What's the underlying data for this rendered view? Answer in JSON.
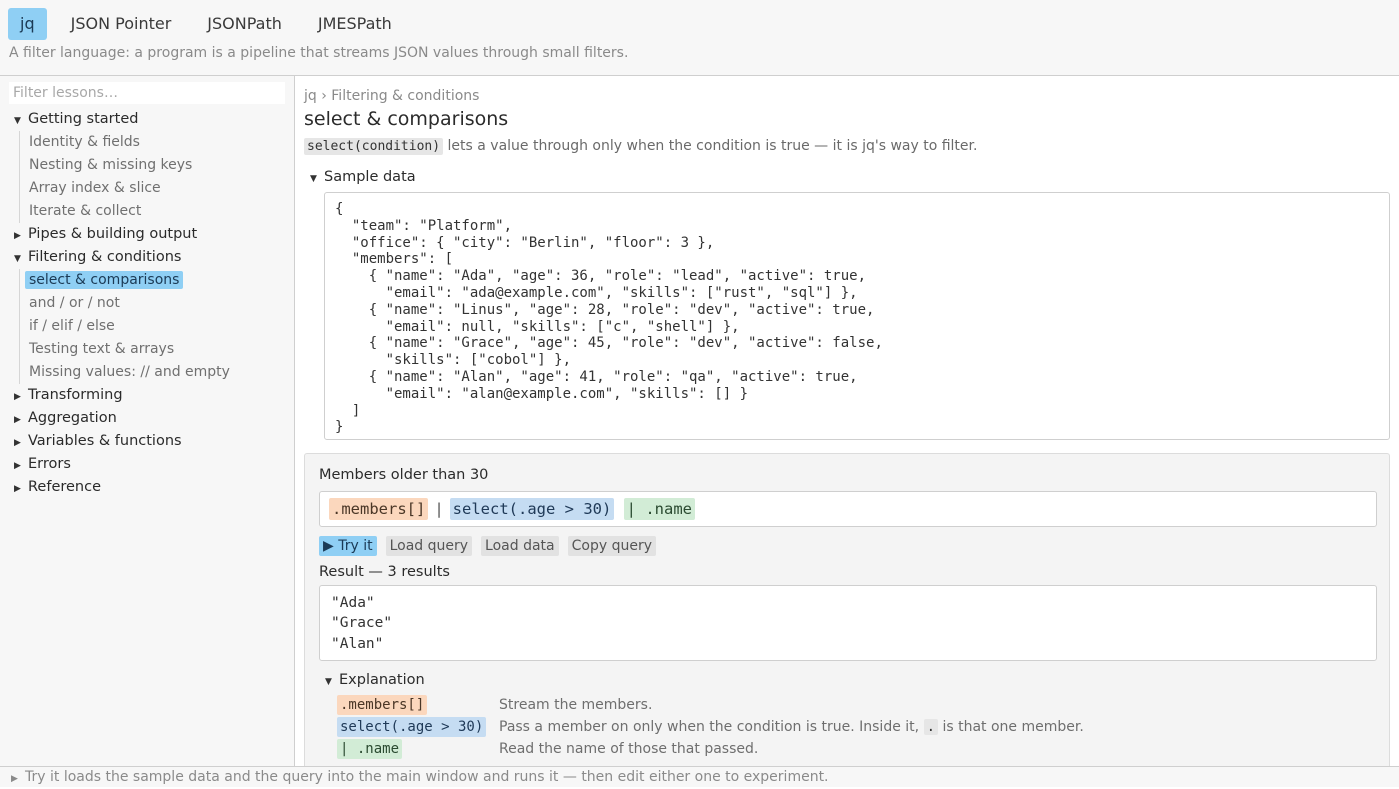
{
  "tabs": [
    {
      "label": "jq",
      "active": true
    },
    {
      "label": "JSON Pointer",
      "active": false
    },
    {
      "label": "JSONPath",
      "active": false
    },
    {
      "label": "JMESPath",
      "active": false
    }
  ],
  "subtitle": "A filter language: a program is a pipeline that streams JSON values through small filters.",
  "sidebar": {
    "filter_placeholder": "Filter lessons…",
    "groups": [
      {
        "label": "Getting started",
        "expanded": true,
        "items": [
          "Identity & fields",
          "Nesting & missing keys",
          "Array index & slice",
          "Iterate & collect"
        ]
      },
      {
        "label": "Pipes & building output",
        "expanded": false,
        "items": []
      },
      {
        "label": "Filtering & conditions",
        "expanded": true,
        "items": [
          "select & comparisons",
          "and / or / not",
          "if / elif / else",
          "Testing text & arrays",
          "Missing values: // and empty"
        ]
      },
      {
        "label": "Transforming",
        "expanded": false,
        "items": []
      },
      {
        "label": "Aggregation",
        "expanded": false,
        "items": []
      },
      {
        "label": "Variables & functions",
        "expanded": false,
        "items": []
      },
      {
        "label": "Errors",
        "expanded": false,
        "items": []
      },
      {
        "label": "Reference",
        "expanded": false,
        "items": []
      }
    ],
    "selected_item": "select & comparisons"
  },
  "main": {
    "breadcrumb": "jq › Filtering & conditions",
    "title": "select & comparisons",
    "intro_code": "select(condition)",
    "intro_text": " lets a value through only when the condition is true — it is jq's way to filter.",
    "sample_label": "Sample data",
    "sample_json": "{\n  \"team\": \"Platform\",\n  \"office\": { \"city\": \"Berlin\", \"floor\": 3 },\n  \"members\": [\n    { \"name\": \"Ada\", \"age\": 36, \"role\": \"lead\", \"active\": true,\n      \"email\": \"ada@example.com\", \"skills\": [\"rust\", \"sql\"] },\n    { \"name\": \"Linus\", \"age\": 28, \"role\": \"dev\", \"active\": true,\n      \"email\": null, \"skills\": [\"c\", \"shell\"] },\n    { \"name\": \"Grace\", \"age\": 45, \"role\": \"dev\", \"active\": false,\n      \"skills\": [\"cobol\"] },\n    { \"name\": \"Alan\", \"age\": 41, \"role\": \"qa\", \"active\": true,\n      \"email\": \"alan@example.com\", \"skills\": [] }\n  ]\n}",
    "example": {
      "title": "Members older than 30",
      "query_parts": [
        ".members[]",
        "|",
        "select(.age > 30)",
        "| .name"
      ],
      "buttons": {
        "try": "▶ Try it",
        "load_query": "Load query",
        "load_data": "Load data",
        "copy_query": "Copy query"
      },
      "result_label": "Result — 3 results",
      "results": [
        "\"Ada\"",
        "\"Grace\"",
        "\"Alan\""
      ],
      "explanation_label": "Explanation",
      "explanation": [
        {
          "code": ".members[]",
          "text": "Stream the members."
        },
        {
          "code": "select(.age > 30)",
          "text_before": "Pass a member on only when the condition is true. Inside it, ",
          "text_code": ".",
          "text_after": " is that one member."
        },
        {
          "code": "| .name",
          "text": "Read the name of those that passed."
        }
      ]
    }
  },
  "statusbar": {
    "text": "Try it loads the sample data and the query into the main window and runs it — then edit either one to experiment."
  },
  "colors": {
    "accent": "#8fcff4",
    "seg_orange": "#fbd7bd",
    "seg_blue": "#c5dcf2",
    "seg_green": "#d2ecd6"
  },
  "icons": {
    "expanded": "triangle-down-icon",
    "collapsed": "triangle-right-icon"
  }
}
